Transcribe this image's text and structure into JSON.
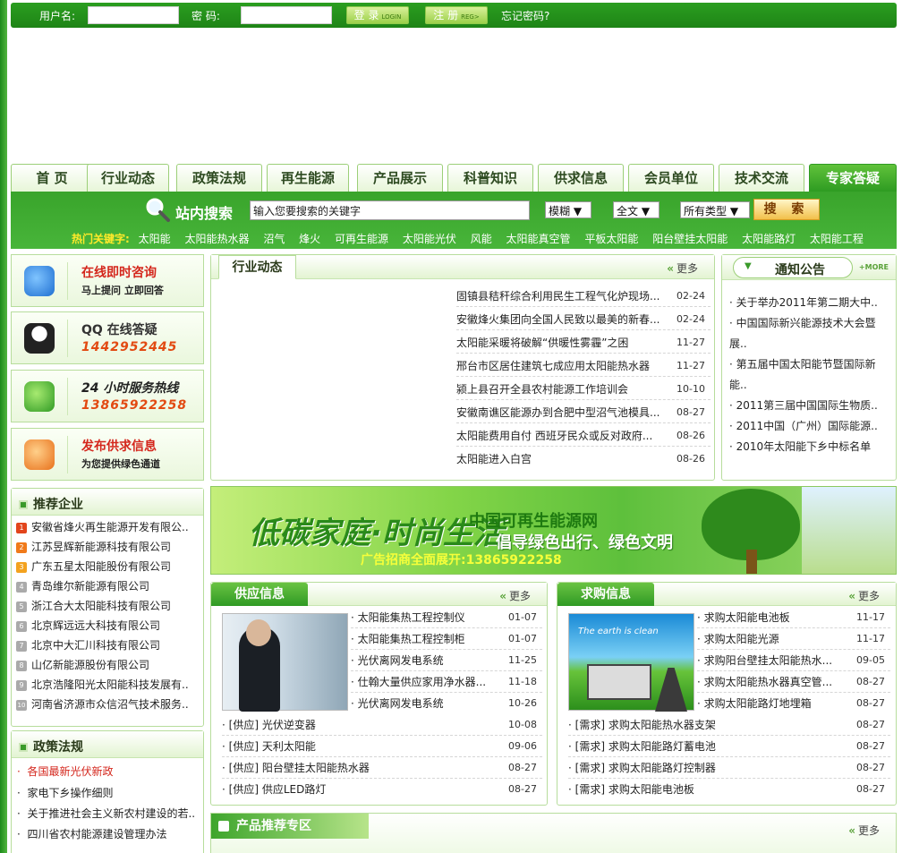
{
  "login": {
    "username_label": "用户名:",
    "password_label": "密  码:",
    "login_btn": "登 录",
    "login_btn_en": "LOGIN",
    "register_btn": "注 册",
    "register_btn_en": "REG>",
    "forgot": "忘记密码?"
  },
  "nav": {
    "tabs": [
      "首 页",
      "行业动态",
      "政策法规",
      "再生能源",
      "产品展示",
      "科普知识",
      "供求信息",
      "会员单位",
      "技术交流",
      "专家答疑"
    ]
  },
  "search": {
    "title": "站内搜索",
    "placeholder": "输入您要搜索的关键字",
    "mode": "模糊",
    "scope": "全文",
    "type": "所有类型",
    "button": "搜 索",
    "hot_label": "热门关键字:",
    "hot": [
      "太阳能",
      "太阳能热水器",
      "沼气",
      "烽火",
      "可再生能源",
      "太阳能光伏",
      "风能",
      "太阳能真空管",
      "平板太阳能",
      "阳台壁挂太阳能",
      "太阳能路灯",
      "太阳能工程"
    ]
  },
  "services": [
    {
      "title": "在线即时咨询",
      "sub": "马上提问 立即回答"
    },
    {
      "title": "QQ 在线答疑",
      "sub": "1442952445"
    },
    {
      "title": "24 小时服务热线",
      "sub": "13865922258"
    },
    {
      "title": "发布供求信息",
      "sub": "为您提供绿色通道"
    }
  ],
  "news": {
    "title": "行业动态",
    "more": "更多",
    "items": [
      {
        "t": "固镇县秸秆综合利用民生工程气化炉现场...",
        "d": "02-24"
      },
      {
        "t": "安徽烽火集团向全国人民致以最美的新春...",
        "d": "02-24"
      },
      {
        "t": "太阳能采暖将破解“供暖性雾霾”之困",
        "d": "11-27"
      },
      {
        "t": "邢台市区居住建筑七成应用太阳能热水器",
        "d": "11-27"
      },
      {
        "t": "颍上县召开全县农村能源工作培训会",
        "d": "10-10"
      },
      {
        "t": "安徽南谯区能源办到合肥中型沼气池模具...",
        "d": "08-27"
      },
      {
        "t": "太阳能费用自付 西班牙民众或反对政府...",
        "d": "08-26"
      },
      {
        "t": "太阳能进入白宫",
        "d": "08-26"
      }
    ]
  },
  "notice": {
    "title": "通知公告",
    "more": "+MORE",
    "items": [
      "关于举办2011年第二期大中..",
      "中国国际新兴能源技术大会暨展..",
      "第五届中国太阳能节暨国际新能..",
      "2011第三届中国国际生物质..",
      "2011中国（广州）国际能源..",
      "2010年太阳能下乡中标名单"
    ]
  },
  "banner": {
    "slogan": "低碳家庭·时尚生活",
    "site": "中国可再生能源网",
    "motto": "倡导绿色出行、绿色文明",
    "ad": "广告招商全面展开:13865922258"
  },
  "supply": {
    "title": "供应信息",
    "more": "更多",
    "pic_items": [
      {
        "t": "太阳能集热工程控制仪",
        "d": "01-07"
      },
      {
        "t": "太阳能集热工程控制柜",
        "d": "01-07"
      },
      {
        "t": "光伏离网发电系统",
        "d": "11-25"
      },
      {
        "t": "仕翰大量供应家用净水器...",
        "d": "11-18"
      },
      {
        "t": "光伏离网发电系统",
        "d": "10-26"
      }
    ],
    "items": [
      {
        "t": "[供应] 光伏逆变器",
        "d": "10-08"
      },
      {
        "t": "[供应] 天利太阳能",
        "d": "09-06"
      },
      {
        "t": "[供应] 阳台壁挂太阳能热水器",
        "d": "08-27"
      },
      {
        "t": "[供应] 供应LED路灯",
        "d": "08-27"
      }
    ]
  },
  "demand": {
    "title": "求购信息",
    "more": "更多",
    "pic_caption": "The earth is clean",
    "pic_items": [
      {
        "t": "求购太阳能电池板",
        "d": "11-17"
      },
      {
        "t": "求购太阳能光源",
        "d": "11-17"
      },
      {
        "t": "求购阳台壁挂太阳能热水...",
        "d": "09-05"
      },
      {
        "t": "求购太阳能热水器真空管...",
        "d": "08-27"
      },
      {
        "t": "求购太阳能路灯地埋箱",
        "d": "08-27"
      }
    ],
    "items": [
      {
        "t": "[需求] 求购太阳能热水器支架",
        "d": "08-27"
      },
      {
        "t": "[需求] 求购太阳能路灯蓄电池",
        "d": "08-27"
      },
      {
        "t": "[需求] 求购太阳能路灯控制器",
        "d": "08-27"
      },
      {
        "t": "[需求] 求购太阳能电池板",
        "d": "08-27"
      }
    ]
  },
  "enterprises": {
    "title": "推荐企业",
    "items": [
      "安徽省烽火再生能源开发有限公..",
      "江苏昱辉新能源科技有限公司",
      "广东五星太阳能股份有限公司",
      "青岛维尔新能源有限公司",
      "浙江合大太阳能科技有限公司",
      "北京辉远远大科技有限公司",
      "北京中大汇川科技有限公司",
      "山亿新能源股份有限公司",
      "北京浩隆阳光太阳能科技发展有..",
      "河南省济源市众信沼气技术服务.."
    ]
  },
  "policy": {
    "title": "政策法规",
    "items": [
      "各国最新光伏新政",
      "家电下乡操作细则",
      "关于推进社会主义新农村建设的若..",
      "四川省农村能源建设管理办法"
    ]
  },
  "product": {
    "title": "产品推荐专区",
    "more": "更多"
  },
  "colors": {
    "brand": "#2e9b22",
    "accent": "#d4261c",
    "hot": "#ffea2a"
  }
}
